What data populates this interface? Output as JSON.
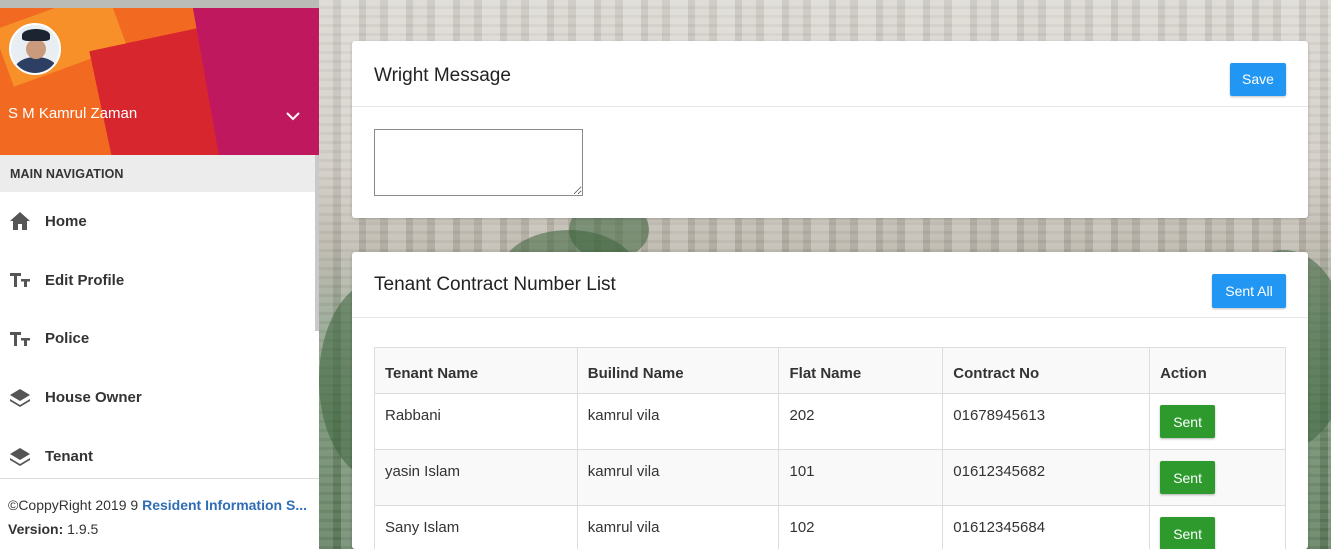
{
  "sidebar": {
    "user_name": "S M Kamrul Zaman",
    "nav_header": "MAIN NAVIGATION",
    "items": [
      {
        "label": "Home",
        "icon": "home-icon"
      },
      {
        "label": "Edit Profile",
        "icon": "text-fields-icon"
      },
      {
        "label": "Police",
        "icon": "text-fields-icon"
      },
      {
        "label": "House Owner",
        "icon": "layers-icon"
      },
      {
        "label": "Tenant",
        "icon": "layers-icon"
      }
    ],
    "footer": {
      "copyright": "©CoppyRight 2019 9 ",
      "app_link": "Resident Information S...",
      "version_label": "Version:",
      "version_value": " 1.9.5"
    }
  },
  "message_card": {
    "title": "Wright Message",
    "save_label": "Save",
    "textarea_value": ""
  },
  "tenant_card": {
    "title": "Tenant Contract Number List",
    "sent_all_label": "Sent All",
    "columns": [
      "Tenant Name",
      "Builind Name",
      "Flat Name",
      "Contract No",
      "Action"
    ],
    "rows": [
      {
        "tenant": "Rabbani",
        "building": "kamrul vila",
        "flat": "202",
        "contract": "01678945613",
        "action": "Sent"
      },
      {
        "tenant": "yasin Islam",
        "building": "kamrul vila",
        "flat": "101",
        "contract": "01612345682",
        "action": "Sent"
      },
      {
        "tenant": "Sany Islam",
        "building": "kamrul vila",
        "flat": "102",
        "contract": "01612345684",
        "action": "Sent"
      }
    ]
  },
  "colors": {
    "primary_button": "#2196f3",
    "success_button": "#2e9a2e",
    "header_orange": "#f7941d",
    "header_red": "#d7262d",
    "header_magenta": "#c0185f"
  }
}
